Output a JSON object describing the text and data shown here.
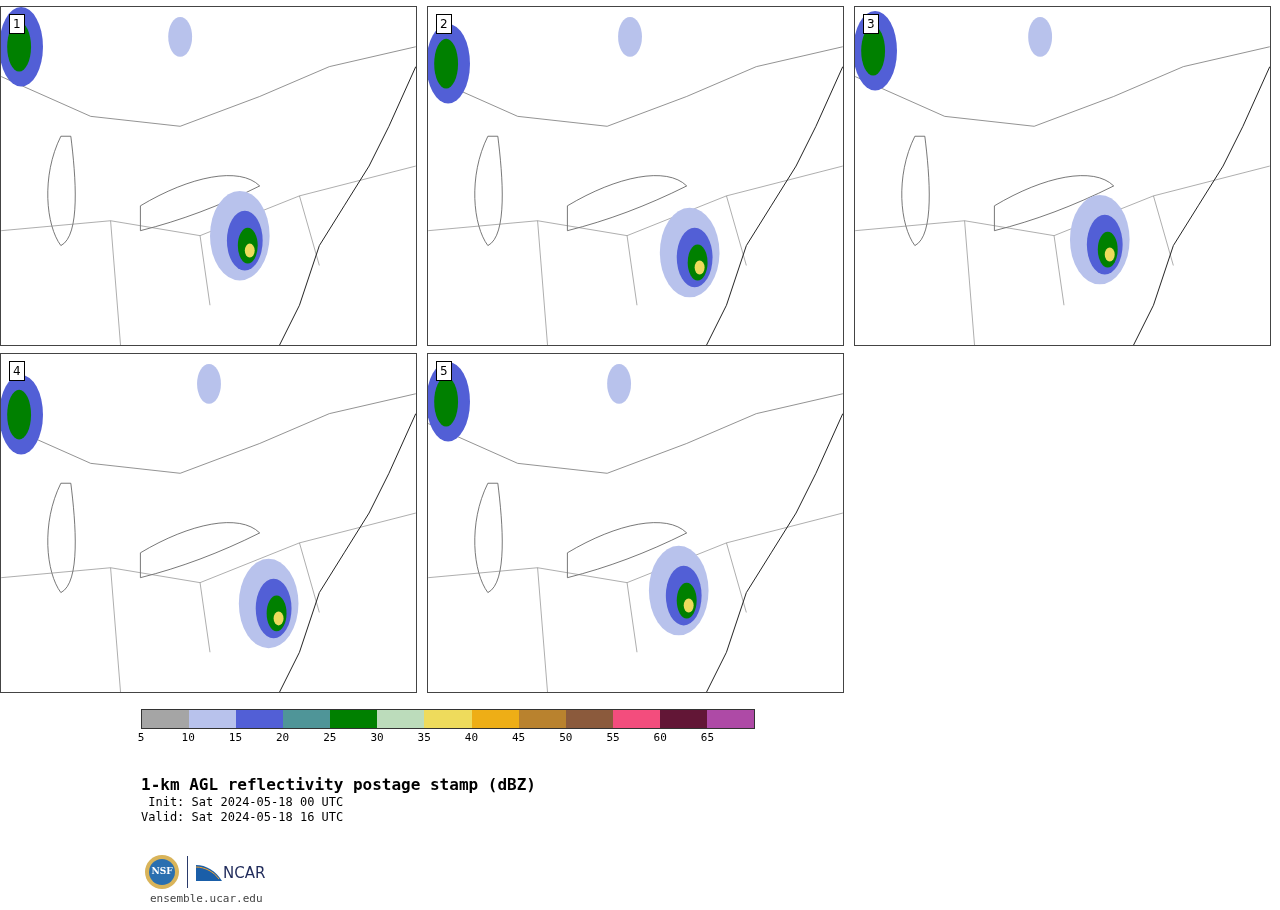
{
  "panels": [
    {
      "label": "1"
    },
    {
      "label": "2"
    },
    {
      "label": "3"
    },
    {
      "label": "4"
    },
    {
      "label": "5"
    }
  ],
  "colorbar": {
    "segments": [
      {
        "color": "#a5a5a5"
      },
      {
        "color": "#b8c2ec"
      },
      {
        "color": "#525fd6"
      },
      {
        "color": "#4f9598"
      },
      {
        "color": "#008000"
      },
      {
        "color": "#bcdcbb"
      },
      {
        "color": "#eedb5c"
      },
      {
        "color": "#eeae16"
      },
      {
        "color": "#b9822e"
      },
      {
        "color": "#8b5a3c"
      },
      {
        "color": "#f34d7d"
      },
      {
        "color": "#621636"
      },
      {
        "color": "#ae4aa6"
      }
    ],
    "ticks": [
      "5",
      "10",
      "15",
      "20",
      "25",
      "30",
      "35",
      "40",
      "45",
      "50",
      "55",
      "60",
      "65"
    ]
  },
  "title": "1-km AGL reflectivity postage stamp (dBZ)",
  "init": " Init: Sat 2024-05-18 00 UTC",
  "valid": "Valid: Sat 2024-05-18 16 UTC",
  "logos": {
    "nsf": "NSF",
    "ncar": "NCAR"
  },
  "site": "ensemble.ucar.edu"
}
